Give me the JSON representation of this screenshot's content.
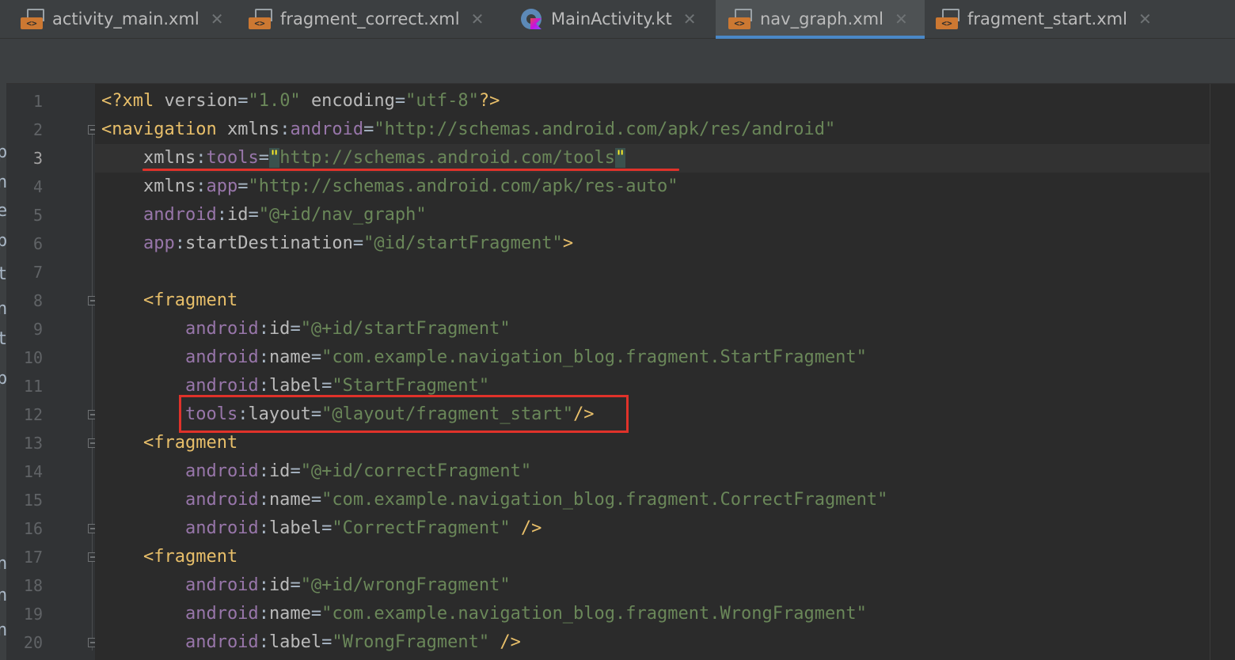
{
  "tabs": [
    {
      "label": "activity_main.xml",
      "icon": "xml-file-icon",
      "active": false
    },
    {
      "label": "fragment_correct.xml",
      "icon": "xml-file-icon",
      "active": false
    },
    {
      "label": "MainActivity.kt",
      "icon": "kotlin-class-icon",
      "active": false
    },
    {
      "label": "nav_graph.xml",
      "icon": "xml-file-icon",
      "active": true
    },
    {
      "label": "fragment_start.xml",
      "icon": "xml-file-icon",
      "active": false
    }
  ],
  "close_glyph": "✕",
  "xml_badge": "<>",
  "left_sliver_chars": [
    "p",
    "n",
    "e",
    "p",
    "tl",
    "n",
    "t",
    "",
    "p",
    "",
    "",
    "n",
    "n",
    "n"
  ],
  "line_numbers": [
    "1",
    "2",
    "3",
    "4",
    "5",
    "6",
    "7",
    "8",
    "9",
    "10",
    "11",
    "12",
    "13",
    "14",
    "15",
    "16",
    "17",
    "18",
    "19",
    "20"
  ],
  "current_line": 3,
  "code": {
    "l1": {
      "a": "<?xml ",
      "b": "version",
      "c": "=",
      "d": "\"1.0\"",
      "e": " ",
      "f": "encoding",
      "g": "=",
      "h": "\"utf-8\"",
      "i": "?>"
    },
    "l2": {
      "a": "<navigation ",
      "b": "xmlns",
      "c": ":",
      "d": "android",
      "e": "=",
      "f": "\"http://schemas.android.com/apk/res/android\""
    },
    "l3": {
      "a": "    xmlns",
      "b": ":",
      "c": "tools",
      "d": "=",
      "e": "\"",
      "f": "http://schemas.android.com/tools",
      "g": "\""
    },
    "l4": {
      "a": "    xmlns",
      "b": ":",
      "c": "app",
      "d": "=",
      "e": "\"http://schemas.android.com/apk/res-auto\""
    },
    "l5": {
      "a": "    android",
      "b": ":",
      "c": "id",
      "d": "=",
      "e": "\"@+id/nav_graph\""
    },
    "l6": {
      "a": "    app",
      "b": ":",
      "c": "startDestination",
      "d": "=",
      "e": "\"@id/startFragment\"",
      "f": ">"
    },
    "l7": {
      "a": ""
    },
    "l8": {
      "a": "    <fragment"
    },
    "l9": {
      "a": "        android",
      "b": ":",
      "c": "id",
      "d": "=",
      "e": "\"@+id/startFragment\""
    },
    "l10": {
      "a": "        android",
      "b": ":",
      "c": "name",
      "d": "=",
      "e": "\"com.example.navigation_blog.fragment.StartFragment\""
    },
    "l11": {
      "a": "        android",
      "b": ":",
      "c": "label",
      "d": "=",
      "e": "\"StartFragment\""
    },
    "l12": {
      "a": "        tools",
      "b": ":",
      "c": "layout",
      "d": "=",
      "e": "\"@layout/fragment_start\"",
      "f": "/>"
    },
    "l13": {
      "a": "    <fragment"
    },
    "l14": {
      "a": "        android",
      "b": ":",
      "c": "id",
      "d": "=",
      "e": "\"@+id/correctFragment\""
    },
    "l15": {
      "a": "        android",
      "b": ":",
      "c": "name",
      "d": "=",
      "e": "\"com.example.navigation_blog.fragment.CorrectFragment\""
    },
    "l16": {
      "a": "        android",
      "b": ":",
      "c": "label",
      "d": "=",
      "e": "\"CorrectFragment\"",
      "f": " />"
    },
    "l17": {
      "a": "    <fragment"
    },
    "l18": {
      "a": "        android",
      "b": ":",
      "c": "id",
      "d": "=",
      "e": "\"@+id/wrongFragment\""
    },
    "l19": {
      "a": "        android",
      "b": ":",
      "c": "name",
      "d": "=",
      "e": "\"com.example.navigation_blog.fragment.WrongFragment\""
    },
    "l20": {
      "a": "        android",
      "b": ":",
      "c": "label",
      "d": "=",
      "e": "\"WrongFragment\"",
      "f": " />"
    }
  },
  "colors": {
    "background": "#2b2b2b",
    "tag": "#e8bf6a",
    "namespace": "#9876aa",
    "string": "#6a8759",
    "annotation": "#e0322a",
    "active_tab_indicator": "#4a88c7"
  }
}
